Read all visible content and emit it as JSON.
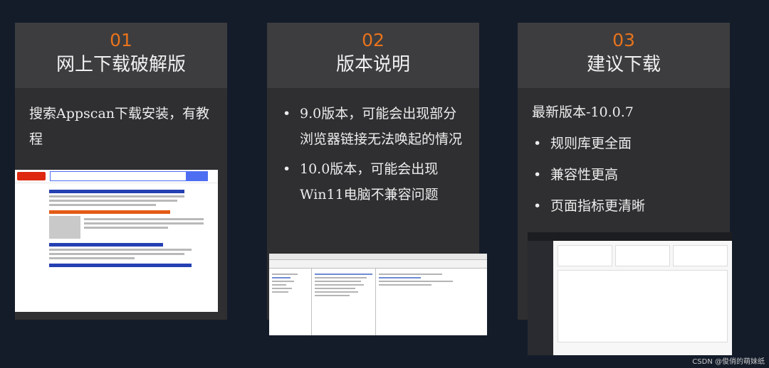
{
  "cards": [
    {
      "number": "01",
      "title": "网上下载破解版",
      "text": "搜索Appscan下载安装，有教程"
    },
    {
      "number": "02",
      "title": "版本说明",
      "bullets": [
        "9.0版本，可能会出现部分浏览器链接无法唤起的情况",
        "10.0版本，可能会出现Win11电脑不兼容问题"
      ]
    },
    {
      "number": "03",
      "title": "建议下载",
      "intro": "最新版本-10.0.7",
      "bullets": [
        "规则库更全面",
        "兼容性更高",
        "页面指标更清晰"
      ]
    }
  ],
  "colors": {
    "background": "#141c2a",
    "card": "#2f2f31",
    "card_head": "#3d3d3f",
    "accent": "#e8731c"
  },
  "footer": "CSDN @俊俏的萌妹纸"
}
